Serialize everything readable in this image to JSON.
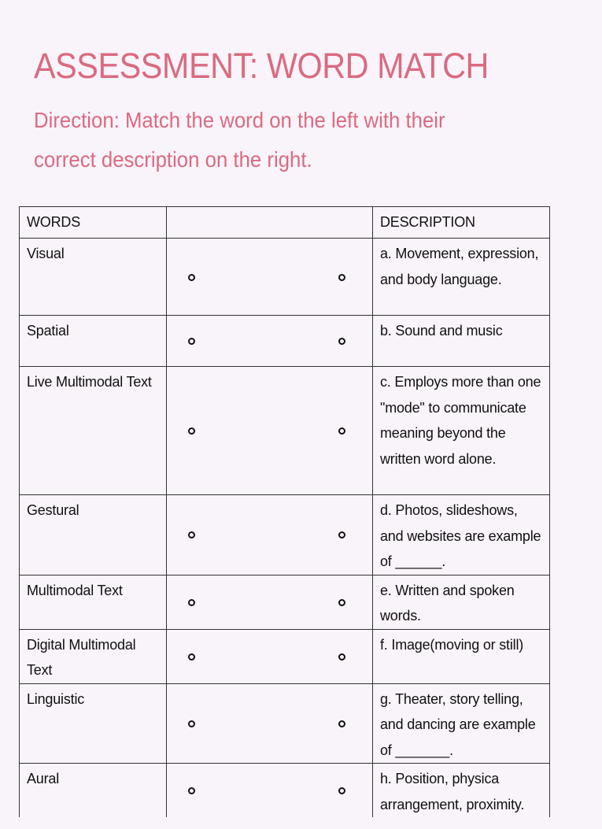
{
  "header": {
    "title": "ASSESSMENT: WORD MATCH",
    "direction": "Direction: Match the word on the left with their correct description on the right."
  },
  "table": {
    "columns": [
      "WORDS",
      "",
      "DESCRIPTION"
    ],
    "rows": [
      {
        "word": "Visual",
        "description": "a. Movement, expression, and body language."
      },
      {
        "word": "Spatial",
        "description": "b. Sound and music"
      },
      {
        "word": "Live Multimodal Text",
        "description": "c. Employs more than one \"mode\" to communicate meaning beyond the written word alone."
      },
      {
        "word": "Gestural",
        "description": "d. Photos, slideshows, and websites are example of ______."
      },
      {
        "word": "Multimodal Text",
        "description": "e. Written and spoken words."
      },
      {
        "word": "Digital Multimodal Text",
        "description": "f. Image(moving or still)"
      },
      {
        "word": "Linguistic",
        "description": "g. Theater, story telling, and dancing are example of _______."
      },
      {
        "word": "Aural",
        "description": "h. Position, physica arrangement, proximity."
      }
    ]
  }
}
